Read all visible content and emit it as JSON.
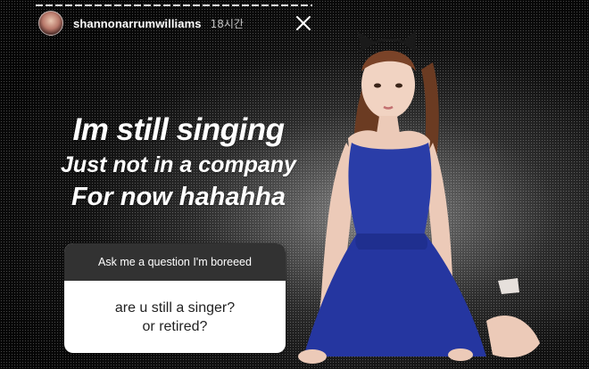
{
  "story": {
    "username": "shannonarrumwilliams",
    "time_ago": "18시간",
    "progress_segments": 30
  },
  "headline": {
    "line1": "Im still singing",
    "line2": "Just not in a company",
    "line3": "For now hahahha"
  },
  "question_sticker": {
    "prompt": "Ask me a question I'm boreeed",
    "answer_line1": "are u still a singer?",
    "answer_line2": "or retired?"
  },
  "icons": {
    "close": "close-icon",
    "avatar": "avatar"
  },
  "colors": {
    "dress": "#2a3da8",
    "sticker_header": "#323232",
    "text": "#ffffff"
  }
}
